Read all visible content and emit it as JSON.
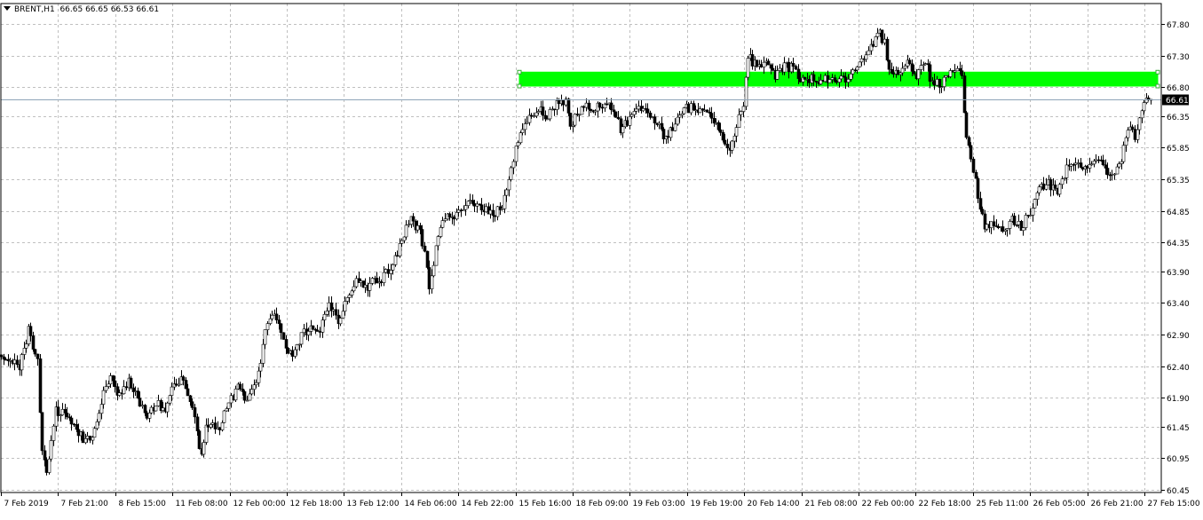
{
  "chart_data": {
    "type": "candlestick",
    "symbol_label": "BRENT,H1",
    "ohlc_label": "66.65 66.65 66.53 66.61",
    "last_price": 66.61,
    "last_price_label": "66.61",
    "ylim": [
      60.45,
      67.95
    ],
    "y_ticks": [
      "67.80",
      "67.30",
      "66.80",
      "66.35",
      "65.85",
      "65.35",
      "64.85",
      "64.35",
      "63.90",
      "63.40",
      "62.90",
      "62.40",
      "61.90",
      "61.45",
      "60.95",
      "60.45"
    ],
    "x_ticks": [
      "7 Feb 2019",
      "7 Feb 21:00",
      "8 Feb 15:00",
      "11 Feb 08:00",
      "12 Feb 00:00",
      "12 Feb 18:00",
      "13 Feb 12:00",
      "14 Feb 06:00",
      "14 Feb 22:00",
      "15 Feb 16:00",
      "18 Feb 09:00",
      "19 Feb 03:00",
      "19 Feb 19:00",
      "20 Feb 14:00",
      "21 Feb 08:00",
      "22 Feb 00:00",
      "22 Feb 18:00",
      "25 Feb 11:00",
      "26 Feb 05:00",
      "26 Feb 21:00",
      "27 Feb 15:00"
    ],
    "grid": true,
    "zone": {
      "low": 66.82,
      "high": 67.04,
      "start": "15 Feb 16:00",
      "end": "27 Feb 15:00",
      "color": "#00ff00"
    },
    "colors": {
      "up": "#ffffff",
      "down": "#000000",
      "outline": "#000000",
      "grid": "#c0c0c0",
      "price_line": "#8ea4b8"
    },
    "anchors": [
      [
        0,
        62.6
      ],
      [
        8,
        62.4
      ],
      [
        12,
        62.95
      ],
      [
        16,
        62.45
      ],
      [
        18,
        61.0
      ],
      [
        20,
        60.75
      ],
      [
        24,
        61.7
      ],
      [
        28,
        61.65
      ],
      [
        32,
        61.45
      ],
      [
        36,
        61.25
      ],
      [
        40,
        61.2
      ],
      [
        44,
        61.85
      ],
      [
        48,
        62.2
      ],
      [
        52,
        61.95
      ],
      [
        56,
        62.15
      ],
      [
        60,
        61.9
      ],
      [
        64,
        61.55
      ],
      [
        68,
        61.85
      ],
      [
        72,
        61.7
      ],
      [
        76,
        62.1
      ],
      [
        80,
        62.2
      ],
      [
        84,
        61.7
      ],
      [
        88,
        61.0
      ],
      [
        90,
        61.5
      ],
      [
        96,
        61.45
      ],
      [
        100,
        61.8
      ],
      [
        104,
        62.05
      ],
      [
        108,
        61.9
      ],
      [
        112,
        62.1
      ],
      [
        116,
        62.95
      ],
      [
        120,
        63.25
      ],
      [
        124,
        62.8
      ],
      [
        128,
        62.5
      ],
      [
        132,
        62.9
      ],
      [
        136,
        63.0
      ],
      [
        140,
        62.95
      ],
      [
        144,
        63.4
      ],
      [
        148,
        63.1
      ],
      [
        152,
        63.5
      ],
      [
        156,
        63.8
      ],
      [
        160,
        63.65
      ],
      [
        164,
        63.75
      ],
      [
        168,
        63.8
      ],
      [
        172,
        64.0
      ],
      [
        176,
        64.4
      ],
      [
        180,
        64.7
      ],
      [
        184,
        64.55
      ],
      [
        186,
        64.2
      ],
      [
        188,
        63.6
      ],
      [
        192,
        64.5
      ],
      [
        196,
        64.75
      ],
      [
        200,
        64.75
      ],
      [
        204,
        64.95
      ],
      [
        208,
        65.0
      ],
      [
        212,
        64.9
      ],
      [
        216,
        64.75
      ],
      [
        220,
        64.95
      ],
      [
        224,
        65.55
      ],
      [
        228,
        66.1
      ],
      [
        232,
        66.3
      ],
      [
        236,
        66.45
      ],
      [
        240,
        66.35
      ],
      [
        244,
        66.55
      ],
      [
        248,
        66.6
      ],
      [
        250,
        66.2
      ],
      [
        252,
        66.3
      ],
      [
        256,
        66.5
      ],
      [
        260,
        66.45
      ],
      [
        264,
        66.5
      ],
      [
        268,
        66.5
      ],
      [
        272,
        66.15
      ],
      [
        276,
        66.3
      ],
      [
        280,
        66.55
      ],
      [
        284,
        66.35
      ],
      [
        288,
        66.25
      ],
      [
        292,
        66.0
      ],
      [
        296,
        66.2
      ],
      [
        300,
        66.45
      ],
      [
        304,
        66.5
      ],
      [
        308,
        66.4
      ],
      [
        312,
        66.35
      ],
      [
        316,
        66.1
      ],
      [
        320,
        65.85
      ],
      [
        324,
        66.3
      ],
      [
        326,
        66.55
      ],
      [
        328,
        67.3
      ],
      [
        332,
        67.1
      ],
      [
        336,
        67.15
      ],
      [
        340,
        67.0
      ],
      [
        344,
        67.15
      ],
      [
        348,
        67.1
      ],
      [
        352,
        66.9
      ],
      [
        356,
        66.95
      ],
      [
        360,
        66.9
      ],
      [
        364,
        66.95
      ],
      [
        368,
        66.9
      ],
      [
        372,
        66.95
      ],
      [
        376,
        67.1
      ],
      [
        380,
        67.25
      ],
      [
        384,
        67.55
      ],
      [
        386,
        67.65
      ],
      [
        388,
        67.5
      ],
      [
        390,
        67.1
      ],
      [
        394,
        67.05
      ],
      [
        398,
        67.2
      ],
      [
        402,
        66.95
      ],
      [
        406,
        67.25
      ],
      [
        408,
        66.95
      ],
      [
        412,
        66.85
      ],
      [
        416,
        67.0
      ],
      [
        420,
        67.15
      ],
      [
        422,
        67.0
      ],
      [
        424,
        65.95
      ],
      [
        426,
        65.7
      ],
      [
        428,
        65.35
      ],
      [
        430,
        64.9
      ],
      [
        432,
        64.6
      ],
      [
        436,
        64.65
      ],
      [
        440,
        64.55
      ],
      [
        444,
        64.7
      ],
      [
        448,
        64.6
      ],
      [
        452,
        64.85
      ],
      [
        456,
        65.2
      ],
      [
        460,
        65.3
      ],
      [
        464,
        65.1
      ],
      [
        468,
        65.5
      ],
      [
        472,
        65.6
      ],
      [
        476,
        65.55
      ],
      [
        480,
        65.65
      ],
      [
        484,
        65.55
      ],
      [
        488,
        65.4
      ],
      [
        492,
        65.7
      ],
      [
        494,
        66.0
      ],
      [
        496,
        66.25
      ],
      [
        498,
        65.9
      ],
      [
        500,
        66.35
      ],
      [
        502,
        66.55
      ],
      [
        505,
        66.61
      ]
    ]
  }
}
